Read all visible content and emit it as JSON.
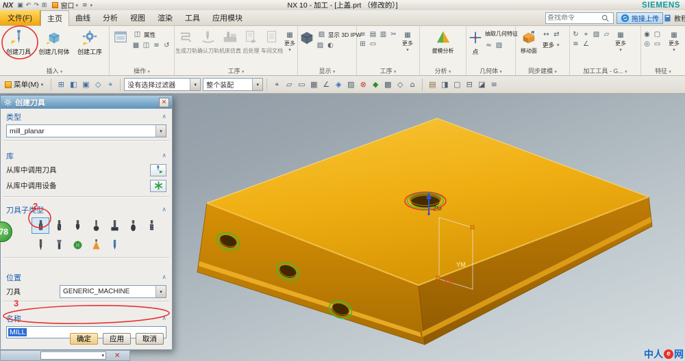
{
  "titlebar": {
    "logo": "NX",
    "icons": [
      "save",
      "undo",
      "redo",
      "print"
    ],
    "window_label": "窗口",
    "title": "NX 10 - 加工 - [上盖.prt （修改的）]",
    "brand": "SIEMENS"
  },
  "tabs": {
    "file": "文件(F)",
    "items": [
      "主页",
      "曲线",
      "分析",
      "视图",
      "渲染",
      "工具",
      "应用模块"
    ],
    "active": "主页",
    "search_placeholder": "查找命令",
    "upload": "拖接上传",
    "tutorial": "教程"
  },
  "ribbon": {
    "groups": [
      {
        "label": "插入",
        "items": [
          {
            "label": "创建刀具"
          },
          {
            "label": "创建几何体"
          },
          {
            "label": "创建工序"
          }
        ]
      },
      {
        "label": "操作",
        "items": [
          {
            "label": "属性"
          }
        ],
        "icons": [
          "edit-object",
          "display-object",
          "object-info",
          "replay"
        ]
      },
      {
        "label": "工序",
        "items": [
          {
            "label": "生成刀轨"
          },
          {
            "label": "确认刀轨"
          },
          {
            "label": "机床仿真"
          },
          {
            "label": "后处理"
          },
          {
            "label": "车间文档"
          },
          {
            "label": "更多"
          }
        ]
      },
      {
        "label": "显示",
        "items": [
          {
            "label": "显示 3D IPW"
          }
        ],
        "icons": [
          "toolpath-display",
          "contrast"
        ]
      },
      {
        "label": "工序",
        "items": [
          {
            "label": "更多"
          }
        ],
        "icons": [
          "list",
          "copy",
          "paste",
          "cut",
          "transform",
          "arrange"
        ]
      },
      {
        "label": "分析",
        "items": [
          {
            "label": "拔模分析"
          }
        ]
      },
      {
        "label": "几何体",
        "items": [
          {
            "label": "点"
          },
          {
            "label": "抽取几何特征"
          }
        ],
        "icons": [
          "curve",
          "face-region"
        ]
      },
      {
        "label": "同步建模",
        "items": [
          {
            "label": "移动面"
          },
          {
            "label": "更多"
          }
        ],
        "icons": [
          "offset",
          "replace"
        ]
      },
      {
        "label": "加工工具 - G...",
        "items": [
          {
            "label": "更多"
          }
        ],
        "icons": [
          "cycle",
          "probe",
          "pattern",
          "boundary",
          "levels",
          "align"
        ]
      },
      {
        "label": "特征",
        "items": [
          {
            "label": "更多"
          }
        ],
        "icons": [
          "hole",
          "pocket",
          "boss",
          "slot"
        ]
      }
    ]
  },
  "toolbar": {
    "menu": "菜单(M)",
    "filter": "没有选择过滤器",
    "scope": "整个装配",
    "icons_a": [
      "select-grid",
      "select-face",
      "select-body",
      "select-edge",
      "snap-point"
    ],
    "icons_b": [
      "crosshair",
      "workplane",
      "rect-select",
      "grid",
      "angle-snap",
      "diamond",
      "mesh",
      "stop-record",
      "ok-accept",
      "solid-view",
      "wire-view",
      "home-view"
    ],
    "icons_c": [
      "shaded",
      "half-shade",
      "outline",
      "section",
      "iso-view",
      "layers"
    ]
  },
  "dialog": {
    "title": "创建刀具",
    "type_section": "类型",
    "type_value": "mill_planar",
    "library_section": "库",
    "lib_tool": "从库中调用刀具",
    "lib_device": "从库中调用设备",
    "subtype_section": "刀具子类型",
    "location_section": "位置",
    "tool_label": "刀具",
    "tool_value": "GENERIC_MACHINE",
    "name_section": "名称",
    "name_value": "MILL",
    "ok": "确定",
    "apply": "应用",
    "cancel": "取消"
  },
  "viewport": {
    "axis_z": "ZM",
    "axis_y": "YM",
    "axis_x": "XM",
    "badge": "78"
  },
  "annotations": {
    "step2": "2",
    "step3": "3"
  },
  "footer_logo": {
    "p1": "中人",
    "p2": "e",
    "p3": "网"
  }
}
